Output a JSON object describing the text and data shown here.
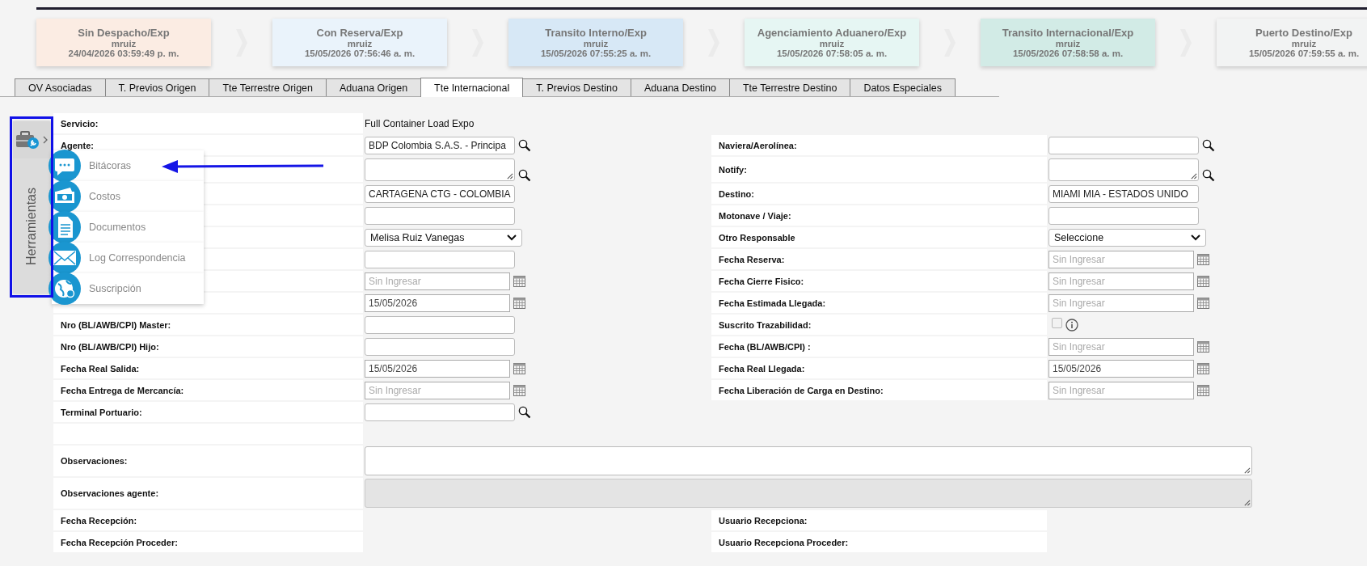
{
  "stages": [
    {
      "title": "Sin Despacho/Exp",
      "user": "mruiz",
      "date": "24/04/2026 03:59:49 p. m.",
      "color": "#fbece3"
    },
    {
      "title": "Con Reserva/Exp",
      "user": "mruiz",
      "date": "15/05/2026 07:56:46 a. m.",
      "color": "#eaf3fb"
    },
    {
      "title": "Transito Interno/Exp",
      "user": "mruiz",
      "date": "15/05/2026 07:55:25 a. m.",
      "color": "#d7e8f6"
    },
    {
      "title": "Agenciamiento Aduanero/Exp",
      "user": "mruiz",
      "date": "15/05/2026 07:58:05 a. m.",
      "color": "#e6f6f3"
    },
    {
      "title": "Transito Internacional/Exp",
      "user": "mruiz",
      "date": "15/05/2026 07:58:58 a. m.",
      "color": "#d2ebe6"
    },
    {
      "title": "Puerto Destino/Exp",
      "user": "mruiz",
      "date": "15/05/2026 07:59:55 a. m.",
      "color": "#f2f3f3"
    }
  ],
  "tabs": [
    {
      "label": "OV Asociadas",
      "selected": false
    },
    {
      "label": "T. Previos Origen",
      "selected": false
    },
    {
      "label": "Tte Terrestre Origen",
      "selected": false
    },
    {
      "label": "Aduana Origen",
      "selected": false
    },
    {
      "label": "Tte Internacional",
      "selected": true
    },
    {
      "label": "T. Previos Destino",
      "selected": false
    },
    {
      "label": "Aduana Destino",
      "selected": false
    },
    {
      "label": "Tte Terrestre Destino",
      "selected": false
    },
    {
      "label": "Datos Especiales",
      "selected": false
    }
  ],
  "tools": {
    "label": "Herramientas",
    "expanded": true,
    "items": [
      {
        "label": "Bitácoras",
        "kind": "chat"
      },
      {
        "label": "Costos",
        "kind": "money"
      },
      {
        "label": "Documentos",
        "kind": "document"
      },
      {
        "label": "Log Correspondencia",
        "kind": "mail"
      },
      {
        "label": "Suscripción",
        "kind": "globe"
      }
    ]
  },
  "form": {
    "rows": [
      {
        "kind": "pair",
        "left": {
          "label": "Servicio:",
          "field": {
            "kind": "static",
            "value": "Full Container Load Expo"
          }
        }
      },
      {
        "kind": "pair",
        "left": {
          "label": "Agente:",
          "field": {
            "kind": "text",
            "value": "BDP Colombia S.A.S. - Principa",
            "search": true
          }
        },
        "right": {
          "label": "Naviera/Aerolínea:",
          "field": {
            "kind": "text",
            "search": true
          }
        }
      },
      {
        "kind": "pair",
        "left": {
          "field": {
            "kind": "textarea",
            "search": true
          }
        },
        "right": {
          "label": "Notify:",
          "field": {
            "kind": "textarea",
            "search": true
          }
        }
      },
      {
        "kind": "pair",
        "left": {
          "field": {
            "kind": "text",
            "value": "CARTAGENA CTG - COLOMBIA"
          }
        },
        "right": {
          "label": "Destino:",
          "field": {
            "kind": "text",
            "value": "MIAMI MIA - ESTADOS UNIDO"
          }
        }
      },
      {
        "kind": "pair",
        "left": {
          "field": {
            "kind": "text"
          }
        },
        "right": {
          "label": "Motonave / Viaje:",
          "field": {
            "kind": "text"
          }
        }
      },
      {
        "kind": "pair",
        "left": {
          "field": {
            "kind": "select",
            "value": "Melisa Ruiz Vanegas"
          }
        },
        "right": {
          "label": "Otro Responsable",
          "field": {
            "kind": "select",
            "value": "Seleccione"
          }
        }
      },
      {
        "kind": "pair",
        "left": {
          "field": {
            "kind": "text"
          }
        },
        "right": {
          "label": "Fecha Reserva:",
          "field": {
            "kind": "date",
            "placeholder": "Sin Ingresar"
          }
        }
      },
      {
        "kind": "pair",
        "left": {
          "field": {
            "kind": "date",
            "placeholder": "Sin Ingresar"
          }
        },
        "right": {
          "label": "Fecha Cierre Fisico:",
          "field": {
            "kind": "date",
            "placeholder": "Sin Ingresar"
          }
        }
      },
      {
        "kind": "pair",
        "left": {
          "field": {
            "kind": "date",
            "value": "15/05/2026"
          }
        },
        "right": {
          "label": "Fecha Estimada Llegada:",
          "field": {
            "kind": "date",
            "placeholder": "Sin Ingresar"
          }
        }
      },
      {
        "kind": "pair",
        "left": {
          "label": "Nro (BL/AWB/CPI) Master:",
          "field": {
            "kind": "text"
          }
        },
        "right": {
          "label": "Suscrito Trazabilidad:",
          "field": {
            "kind": "checkbox",
            "checked": false,
            "disabled": true,
            "info": true
          }
        }
      },
      {
        "kind": "pair",
        "left": {
          "label": "Nro (BL/AWB/CPI) Hijo:",
          "field": {
            "kind": "text"
          }
        },
        "right": {
          "label": "Fecha (BL/AWB/CPI) :",
          "field": {
            "kind": "date",
            "placeholder": "Sin Ingresar"
          }
        }
      },
      {
        "kind": "pair",
        "left": {
          "label": "Fecha Real Salida:",
          "field": {
            "kind": "date",
            "value": "15/05/2026"
          }
        },
        "right": {
          "label": "Fecha Real Llegada:",
          "field": {
            "kind": "date",
            "value": "15/05/2026"
          }
        }
      },
      {
        "kind": "pair",
        "left": {
          "label": "Fecha Entrega de Mercancía:",
          "field": {
            "kind": "date",
            "placeholder": "Sin Ingresar"
          }
        },
        "right": {
          "label": "Fecha Liberación de Carga en Destino:",
          "field": {
            "kind": "date",
            "placeholder": "Sin Ingresar"
          }
        }
      },
      {
        "kind": "pair",
        "left": {
          "label": "Terminal Portuario:",
          "field": {
            "kind": "text",
            "search": true
          }
        }
      },
      {
        "kind": "spacer"
      },
      {
        "kind": "wide",
        "label": "Observaciones:",
        "disabled": false
      },
      {
        "kind": "wide",
        "label": "Observaciones agente:",
        "disabled": true
      },
      {
        "kind": "pair",
        "left": {
          "label": "Fecha Recepción:"
        },
        "right": {
          "label": "Usuario Recepciona:"
        }
      },
      {
        "kind": "pair",
        "left": {
          "label": "Fecha Recepción Proceder:"
        },
        "right": {
          "label": "Usuario Recepciona Proceder:"
        }
      }
    ]
  }
}
